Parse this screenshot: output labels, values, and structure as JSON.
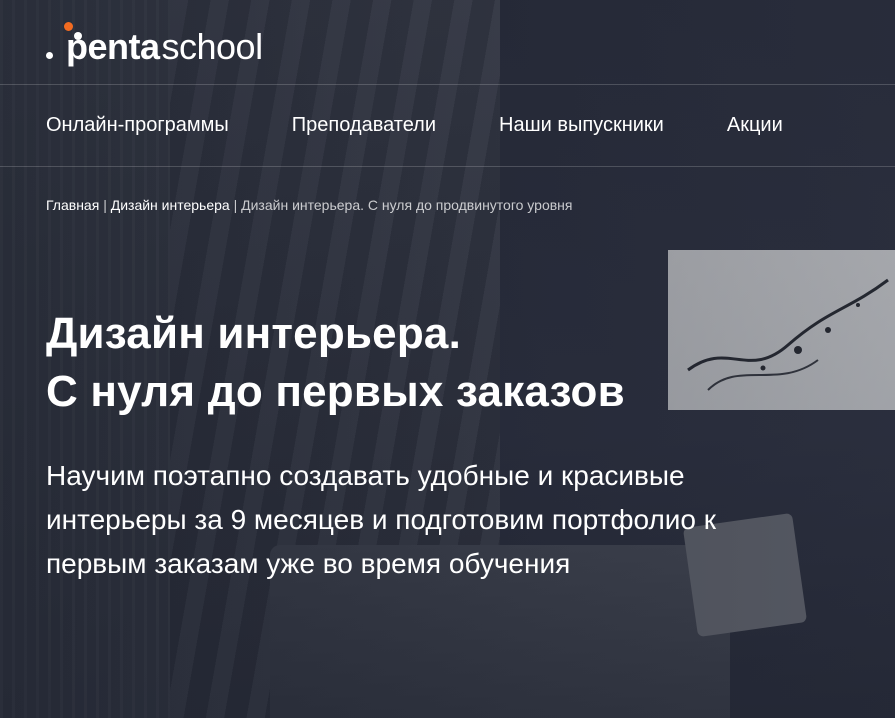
{
  "logo": {
    "mark": "penta",
    "suffix": "school"
  },
  "nav": {
    "items": [
      {
        "label": "Онлайн-программы"
      },
      {
        "label": "Преподаватели"
      },
      {
        "label": "Наши выпускники"
      },
      {
        "label": "Акции"
      }
    ]
  },
  "breadcrumb": {
    "home": "Главная",
    "separator": "|",
    "category": "Дизайн интерьера",
    "current": "Дизайн интерьера. С нуля до продвинутого уровня"
  },
  "hero": {
    "title_line1": "Дизайн интерьера.",
    "title_line2": "С нуля до первых заказов",
    "subtitle": "Научим поэтапно создавать удобные и красивые интерьеры за 9 месяцев и подготовим портфолио к первым заказам уже во время обучения"
  },
  "colors": {
    "accent": "#f26b21",
    "background": "#2c3140",
    "text": "#ffffff"
  }
}
